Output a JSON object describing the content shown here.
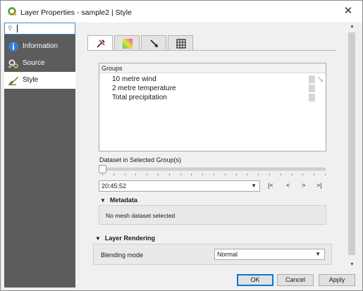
{
  "window": {
    "title": "Layer Properties - sample2 | Style",
    "close_symbol": "✕",
    "app_icon": "qgis-logo-icon"
  },
  "sidebar": {
    "search": {
      "value": "",
      "icon": "search-icon"
    },
    "items": [
      {
        "label": "Information",
        "icon": "info-icon",
        "active": false
      },
      {
        "label": "Source",
        "icon": "source-settings-icon",
        "active": false
      },
      {
        "label": "Style",
        "icon": "paintbrush-icon",
        "active": true
      }
    ]
  },
  "tabs": [
    {
      "icon": "tools-icon",
      "active": true
    },
    {
      "icon": "color-ramp-icon",
      "active": false
    },
    {
      "icon": "vector-arrow-icon",
      "active": false
    },
    {
      "icon": "mesh-grid-icon",
      "active": false
    }
  ],
  "groups": {
    "header": "Groups",
    "items": [
      {
        "label": "10 metre wind"
      },
      {
        "label": "2 metre temperature"
      },
      {
        "label": "Total precipitation"
      }
    ]
  },
  "dataset": {
    "label": "Dataset in Selected Group(s)",
    "slider_position": 0,
    "time_value": "20:45:52",
    "dropdown_symbol": "▼",
    "nav": {
      "first": "|<",
      "prev": "<",
      "next": ">",
      "last": ">|"
    }
  },
  "metadata": {
    "header": "Metadata",
    "toggle": "▼",
    "message": "No mesh dataset selected"
  },
  "layer_rendering": {
    "header": "Layer Rendering",
    "toggle": "▼",
    "blending_label": "Blending mode",
    "blending_value": "Normal"
  },
  "buttons": {
    "ok": "OK",
    "cancel": "Cancel",
    "apply": "Apply"
  },
  "colors": {
    "sidebar_bg": "#5c5c5c",
    "accent": "#0078d7",
    "focus": "#3b8bd6"
  }
}
